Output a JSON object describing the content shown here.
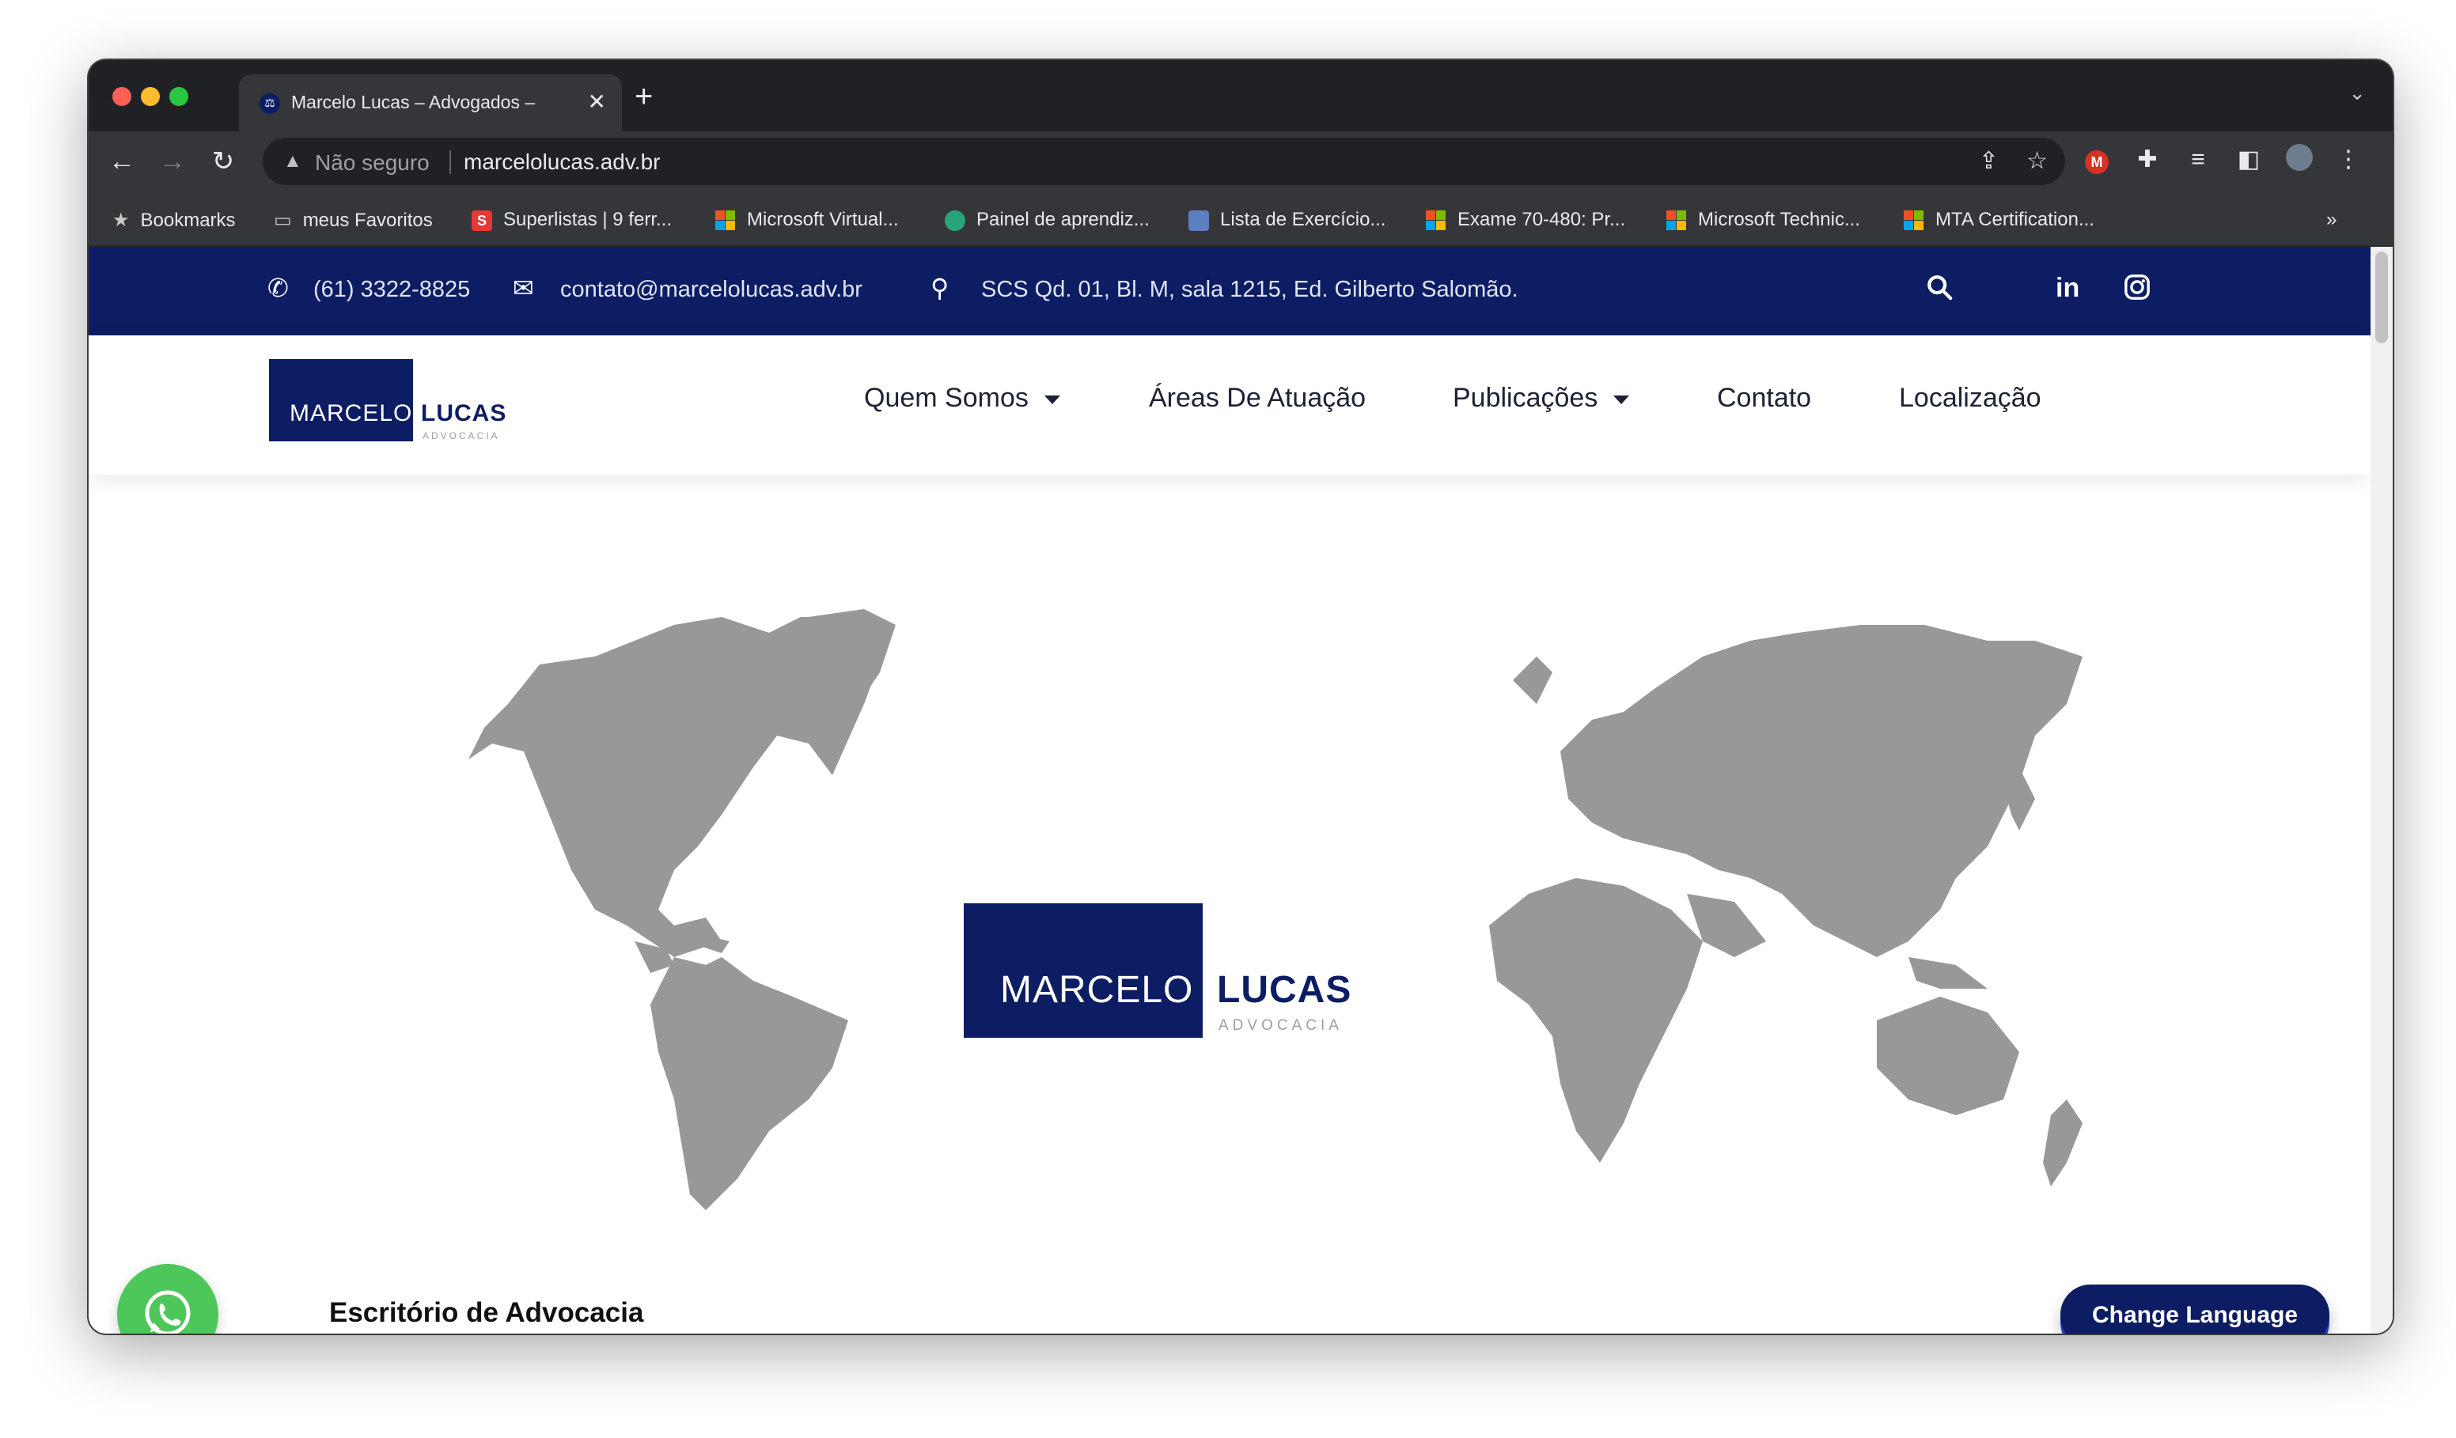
{
  "browser": {
    "tab_title": "Marcelo Lucas – Advogados –",
    "tab_favicon": "scales-icon",
    "address_warning": "Não seguro",
    "url": "marcelolucas.adv.br",
    "bookmarks": [
      {
        "label": "Bookmarks",
        "icon": "star-icon"
      },
      {
        "label": "meus Favoritos",
        "icon": "folder-icon"
      },
      {
        "label": "Superlistas | 9 ferr...",
        "icon": "superlistas-icon"
      },
      {
        "label": "Microsoft Virtual...",
        "icon": "microsoft-icon"
      },
      {
        "label": "Painel de aprendiz...",
        "icon": "shield-icon"
      },
      {
        "label": "Lista de Exercício...",
        "icon": "doc-icon"
      },
      {
        "label": "Exame 70-480: Pr...",
        "icon": "microsoft-icon"
      },
      {
        "label": "Microsoft Technic...",
        "icon": "microsoft-icon"
      },
      {
        "label": "MTA Certification...",
        "icon": "microsoft-icon"
      }
    ],
    "bookmarks_overflow": "»"
  },
  "topbar": {
    "phone": "(61) 3322-8825",
    "email": "contato@marcelolucas.adv.br",
    "address": "SCS Qd. 01, Bl. M, sala 1215, Ed. Gilberto Salomão.",
    "social": [
      "linkedin-icon",
      "instagram-icon"
    ]
  },
  "logo": {
    "word1": "MARCELO",
    "word2": "LUCAS",
    "tagline": "ADVOCACIA"
  },
  "nav": {
    "items": [
      {
        "label": "Quem Somos",
        "dropdown": true
      },
      {
        "label": "Áreas De Atuação",
        "dropdown": false
      },
      {
        "label": "Publicações",
        "dropdown": true
      },
      {
        "label": "Contato",
        "dropdown": false
      },
      {
        "label": "Localização",
        "dropdown": false
      }
    ]
  },
  "hero": {
    "caption": "Escritório de Advocacia",
    "map_color": "#989898"
  },
  "widgets": {
    "change_language": "Change Language",
    "whatsapp": "whatsapp-icon"
  },
  "colors": {
    "brand_navy": "#0d1d63",
    "whatsapp_green": "#4dc75a"
  }
}
